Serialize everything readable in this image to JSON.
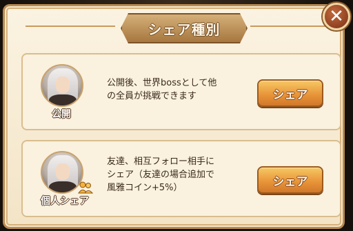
{
  "dialog": {
    "title": "シェア種別",
    "close_icon": "close-icon"
  },
  "options": [
    {
      "avatar_label": "公開",
      "description_lines": [
        "公開後、世界bossとして他",
        "の全員が挑戦できます"
      ],
      "button_label": "シェア"
    },
    {
      "avatar_label": "個人シェア",
      "description_lines": [
        "友達、相互フォロー相手に",
        "シェア（友達の場合追加で",
        "風雅コイン+5%）"
      ],
      "button_label": "シェア"
    }
  ],
  "colors": {
    "panel": "#f3e4c6",
    "banner": "#a77740",
    "button": "#e9963a",
    "close": "#7a2f16"
  }
}
